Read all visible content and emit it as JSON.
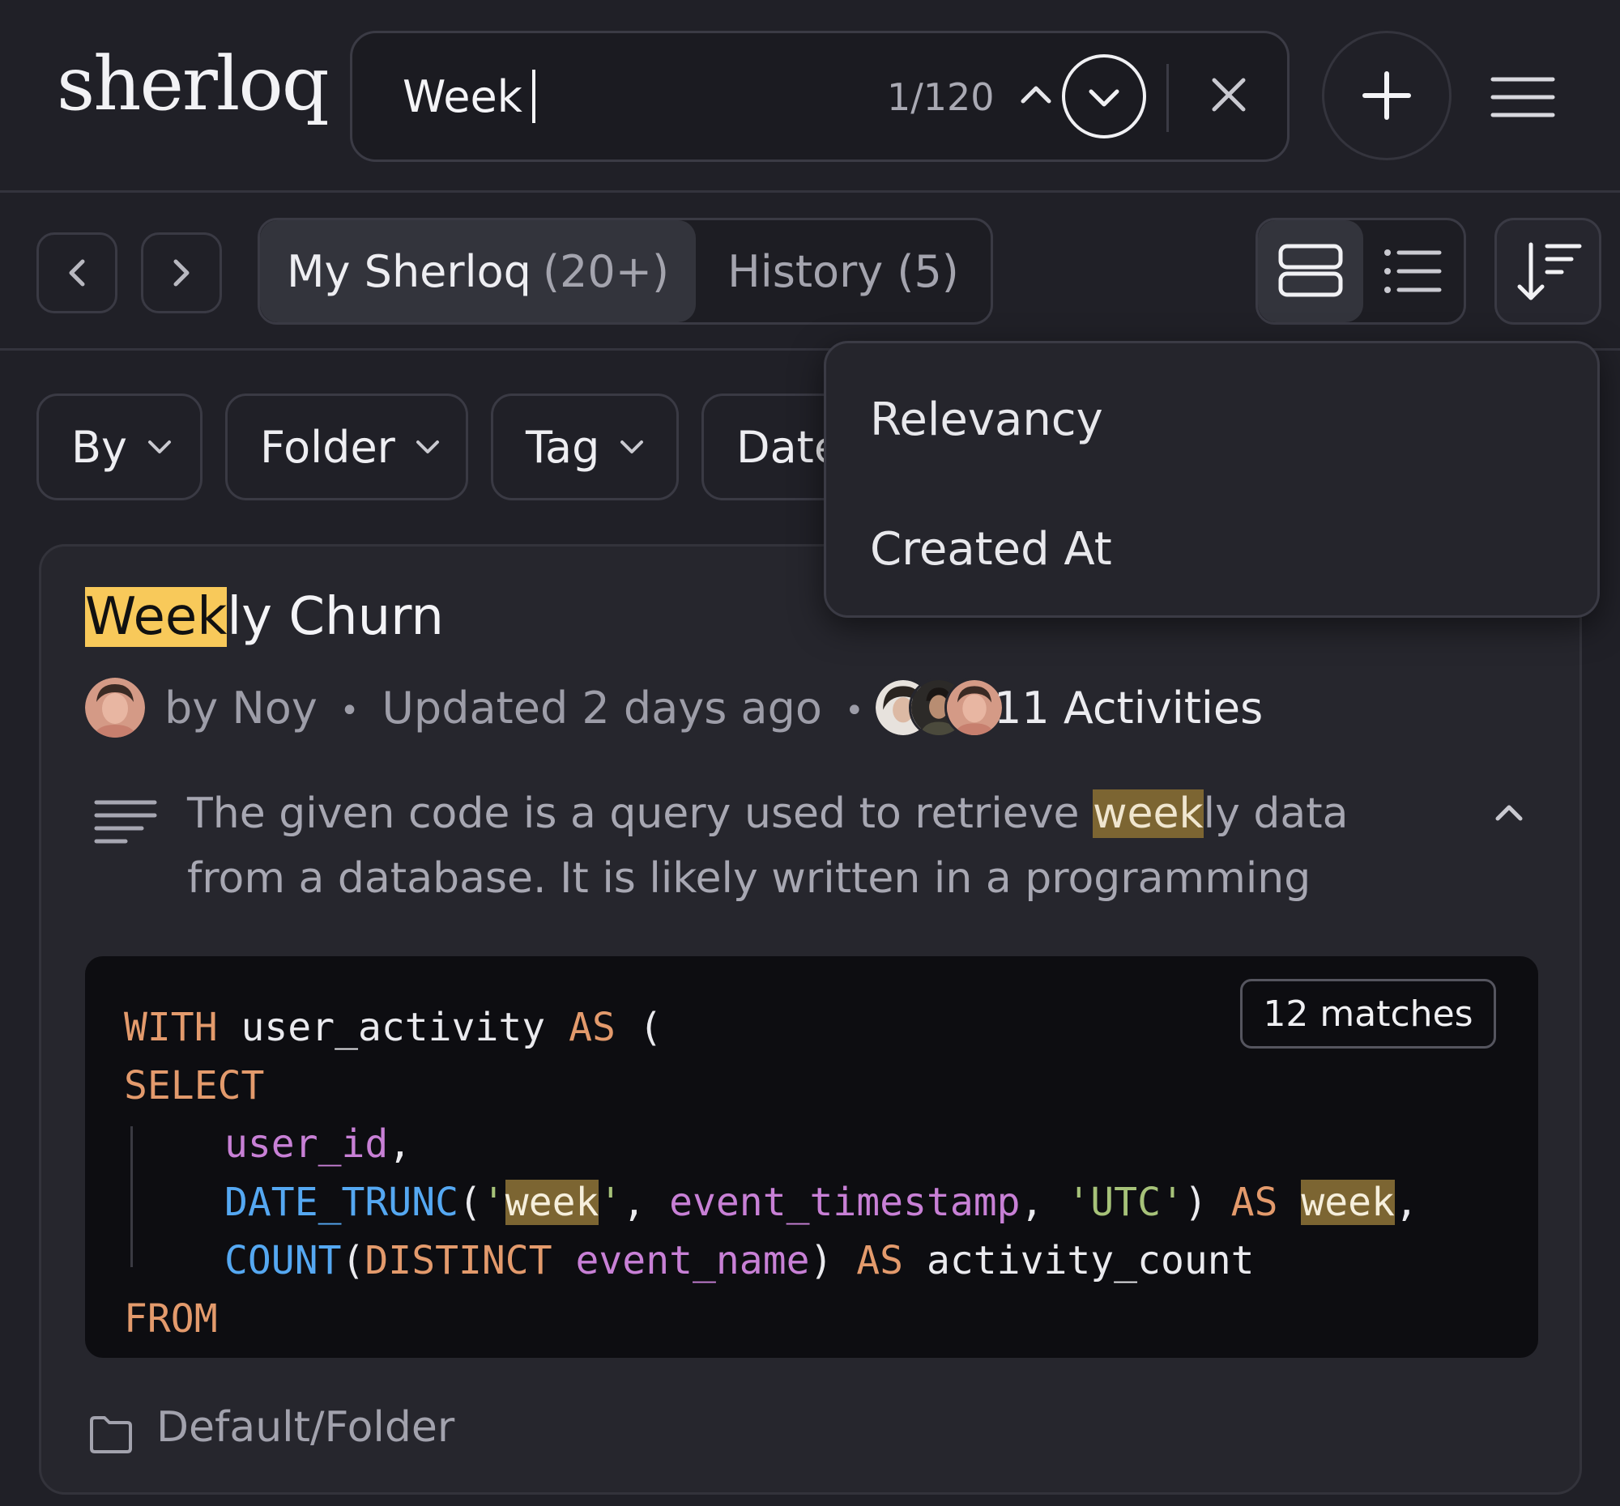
{
  "app": {
    "logo_text": "sherloq"
  },
  "search": {
    "query": "Week",
    "match_count": "1/120"
  },
  "nav": {
    "tabs": [
      {
        "label": "My Sherloq",
        "count": "(20+)"
      },
      {
        "label": "History (5)"
      }
    ]
  },
  "filters": {
    "by": "By",
    "folder": "Folder",
    "tag": "Tag",
    "date": "Date"
  },
  "sort_menu": {
    "items": [
      "Relevancy",
      "Created At"
    ]
  },
  "card": {
    "title_highlight": "Week",
    "title_rest": "ly Churn",
    "author": "by Noy",
    "updated": "Updated 2 days ago",
    "activities": "11 Activities",
    "summary_before": "The given code is a query used to retrieve ",
    "summary_highlight": "week",
    "summary_after": "ly data from a database. It is likely written in a programming",
    "matches": "12 matches",
    "folder": "Default/Folder"
  },
  "code": {
    "l1": {
      "kw1": "WITH",
      "name": " user_activity ",
      "kw2": "AS",
      "rest": " ("
    },
    "l2": {
      "kw": "SELECT"
    },
    "l3": {
      "id": "user_id",
      "rest": ","
    },
    "l4": {
      "fn": "DATE_TRUNC",
      "open": "(",
      "q1": "'",
      "hl1": "week",
      "q2": "'",
      "comma1": ", ",
      "id": "event_timestamp",
      "comma2": ", ",
      "str": "'UTC'",
      "close": ") ",
      "kw": "AS",
      "sp": " ",
      "hl2": "week",
      "comma3": ","
    },
    "l5": {
      "fn": "COUNT",
      "open": "(",
      "kw": "DISTINCT",
      "sp": " ",
      "id": "event_name",
      "close": ") ",
      "kw2": "AS",
      "rest": " activity_count"
    },
    "l6": {
      "kw": "FROM"
    }
  },
  "colors": {
    "background": "#202027",
    "card": "#26262d",
    "title_highlight": "#f8c95a",
    "match_highlight": "#7c6532",
    "keyword": "#e39a6c",
    "function": "#55a8f2",
    "identifier": "#c880d6",
    "string": "#a6c279"
  },
  "icons": [
    "search-next-icon",
    "chevron-up-icon",
    "close-icon",
    "plus-icon",
    "hamburger-icon",
    "chevron-left-icon",
    "chevron-right-icon",
    "card-view-icon",
    "list-view-icon",
    "sort-icon",
    "chevron-down-icon",
    "summary-lines-icon",
    "folder-icon"
  ]
}
